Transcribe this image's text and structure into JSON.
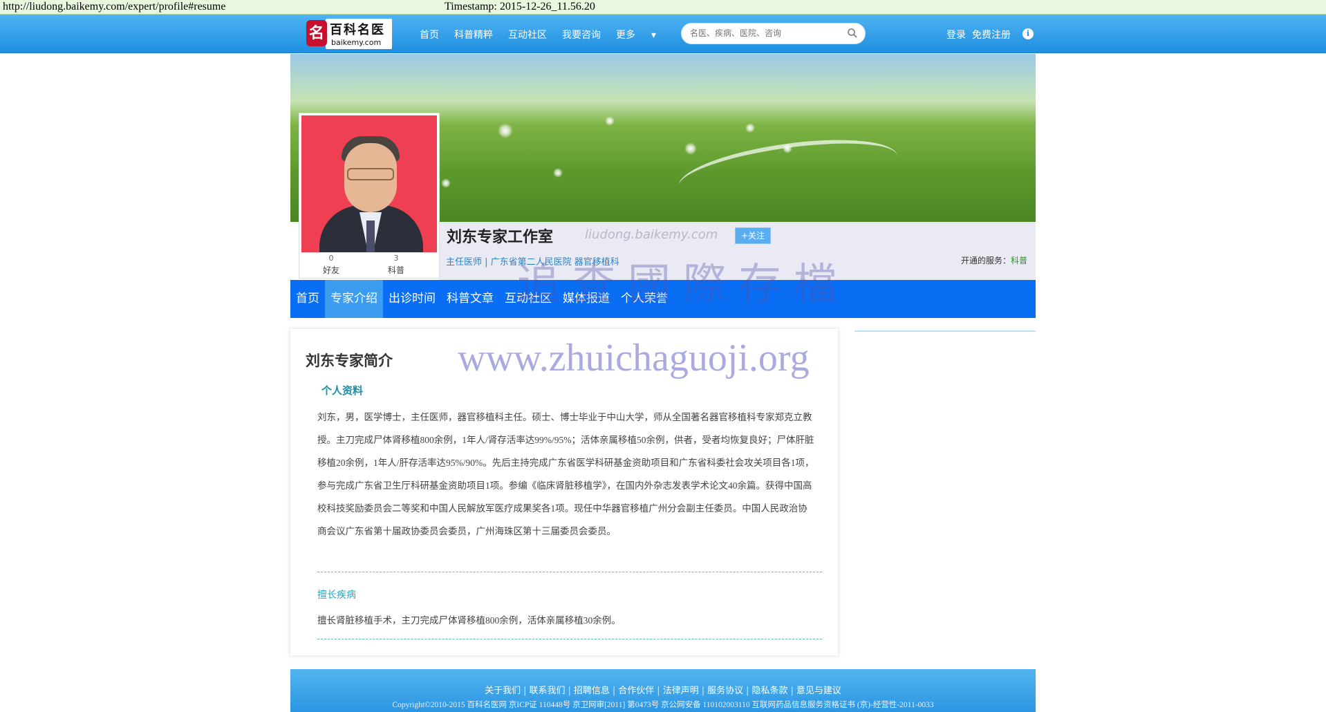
{
  "archive": {
    "url": "http://liudong.baikemy.com/expert/profile#resume",
    "timestamp": "Timestamp: 2015-12-26_11.56.20"
  },
  "site": {
    "logo_cn": "百科名医",
    "logo_en": "baikemy.com",
    "logo_badge": "名",
    "nav": [
      "首页",
      "科普精粹",
      "互动社区",
      "我要咨询",
      "更多"
    ],
    "more_arrow": "▾",
    "search_placeholder": "名医、疾病、医院、咨询",
    "login": "登录",
    "register": "免费注册",
    "info": "i"
  },
  "profile": {
    "friends_count": "0",
    "friends_label": "好友",
    "articles_count": "3",
    "articles_label": "科普",
    "studio_title": "刘东专家工作室",
    "domain": "liudong.baikemy.com",
    "follow": "+关注",
    "subtitle": "主任医师 | 广东省第二人民医院 器官移植科",
    "services_label": "开通的服务：",
    "services_value": "科普"
  },
  "tabs": [
    {
      "label": "首页",
      "active": false
    },
    {
      "label": "专家介绍",
      "active": true
    },
    {
      "label": "出诊时间",
      "active": false
    },
    {
      "label": "科普文章",
      "active": false
    },
    {
      "label": "互动社区",
      "active": false
    },
    {
      "label": "媒体报道",
      "active": false
    },
    {
      "label": "个人荣誉",
      "active": false
    }
  ],
  "watermark": {
    "cn": "追查國際存檔",
    "url": "www.zhuichaguoji.org"
  },
  "content": {
    "heading": "刘东专家简介",
    "section_label": "个人资料",
    "bio": "刘东，男，医学博士，主任医师，器官移植科主任。硕士、博士毕业于中山大学，师从全国著名器官移植科专家郑克立教授。主刀完成尸体肾移植800余例，1年人/肾存活率达99%/95%；活体亲属移植50余例，供者，受者均恢复良好；尸体肝脏移植20余例，1年人/肝存活率达95%/90%。先后主持完成广东省医学科研基金资助项目和广东省科委社会攻关项目各1项，参与完成广东省卫生厅科研基金资助项目1项。参编《临床肾脏移植学》，在国内外杂志发表学术论文40余篇。获得中国高校科技奖励委员会二等奖和中国人民解放军医疗成果奖各1项。现任中华器官移植广州分会副主任委员。中国人民政治协商会议广东省第十届政协委员会委员，广州海珠区第十三届委员会委员。",
    "specialty_title": "擅长疾病",
    "specialty": "擅长肾脏移植手术，主刀完成尸体肾移植800余例，活体亲属移植30余例。"
  },
  "footer": {
    "links": [
      "关于我们",
      "联系我们",
      "招聘信息",
      "合作伙伴",
      "法律声明",
      "服务协议",
      "隐私条款",
      "意见与建议"
    ],
    "separator": "|",
    "copyright": "Copyright©2010-2015 百科名医网 京ICP证 110448号 京卫网审[2011] 第0473号 京公网安备 110102003110   互联网药品信息服务资格证书 (京)-经营性-2011-0033"
  }
}
